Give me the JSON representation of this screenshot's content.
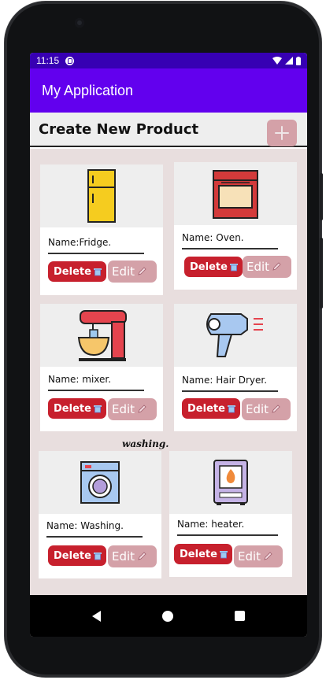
{
  "status_bar": {
    "time": "11:15"
  },
  "app_bar": {
    "title": "My Application"
  },
  "header": {
    "title": "Create New Product",
    "add_icon": "plus-icon"
  },
  "products": [
    {
      "name": "Name:Fridge.",
      "image": "fridge-icon",
      "delete_label": "Delete",
      "edit_label": "Edit"
    },
    {
      "name": "Name: Oven.",
      "image": "oven-icon",
      "delete_label": "Delete",
      "edit_label": "Edit"
    },
    {
      "name": "Name: mixer.",
      "image": "mixer-icon",
      "delete_label": "Delete",
      "edit_label": "Edit"
    },
    {
      "name": "Name: Hair Dryer.",
      "image": "hair-dryer-icon",
      "delete_label": "Delete",
      "edit_label": "Edit"
    },
    {
      "name": "Name:  Washing.",
      "image": "washing-machine-icon",
      "delete_label": "Delete",
      "edit_label": "Edit"
    },
    {
      "name": "Name:  heater.",
      "image": "heater-icon",
      "delete_label": "Delete",
      "edit_label": "Edit"
    }
  ],
  "floating_label": "washing.",
  "colors": {
    "status_bar": "#3700b3",
    "app_bar": "#6200ee",
    "delete_button": "#c7202d",
    "edit_button": "#d4a1a8",
    "grid_background": "#e8dede"
  }
}
